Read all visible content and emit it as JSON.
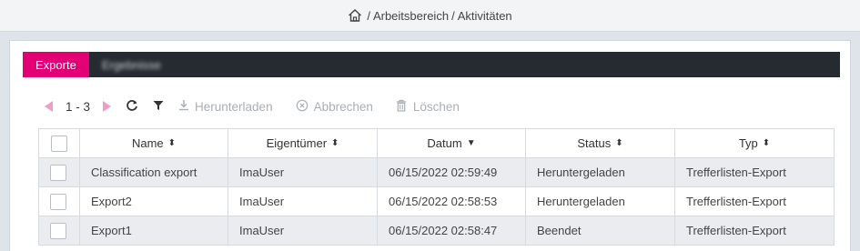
{
  "breadcrumb": {
    "separator": "/",
    "items": [
      "Arbeitsbereich",
      "Aktivitäten"
    ]
  },
  "tabs": [
    {
      "label": "Exporte",
      "active": true
    },
    {
      "label": "Ergebnisse",
      "active": false
    }
  ],
  "toolbar": {
    "range": "1 - 3",
    "download_label": "Herunterladen",
    "cancel_label": "Abbrechen",
    "delete_label": "Löschen"
  },
  "table": {
    "columns": [
      {
        "label": "Name",
        "sort_icon": "sort-both-icon"
      },
      {
        "label": "Eigentümer",
        "sort_icon": "sort-both-icon"
      },
      {
        "label": "Datum",
        "sort_icon": "sort-desc-icon"
      },
      {
        "label": "Status",
        "sort_icon": "sort-both-icon"
      },
      {
        "label": "Typ",
        "sort_icon": "sort-both-icon"
      }
    ],
    "rows": [
      {
        "name": "Classification export",
        "owner": "ImaUser",
        "date": "06/15/2022 02:59:49",
        "status": "Heruntergeladen",
        "type": "Trefferlisten-Export"
      },
      {
        "name": "Export2",
        "owner": "ImaUser",
        "date": "06/15/2022 02:58:53",
        "status": "Heruntergeladen",
        "type": "Trefferlisten-Export"
      },
      {
        "name": "Export1",
        "owner": "ImaUser",
        "date": "06/15/2022 02:58:47",
        "status": "Beendet",
        "type": "Trefferlisten-Export"
      }
    ]
  },
  "colors": {
    "accent": "#e20074",
    "tabbar": "#262b31",
    "pager_arrow": "#f09cc6"
  }
}
